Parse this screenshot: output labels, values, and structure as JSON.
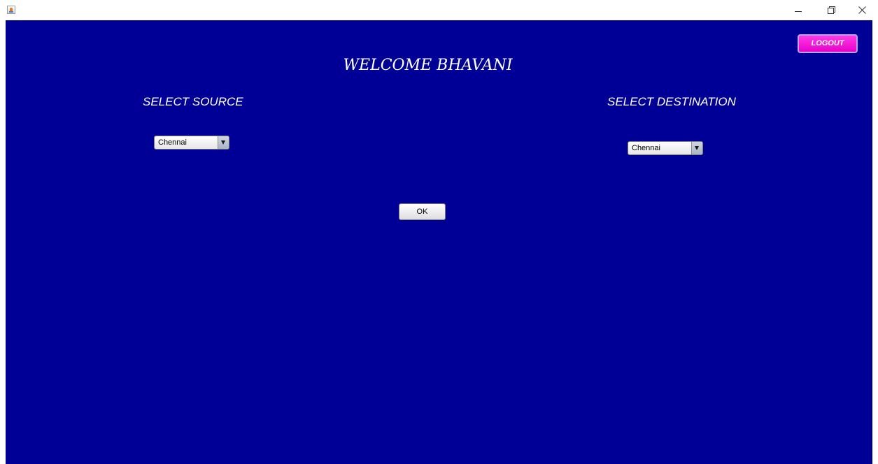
{
  "window": {
    "app_icon": "java-app-icon",
    "controls": [
      "minimize-icon",
      "restore-icon",
      "close-icon"
    ]
  },
  "header": {
    "welcome_text": "WELCOME BHAVANI",
    "logout_label": "LOGOUT"
  },
  "source": {
    "label": "SELECT SOURCE",
    "selected": "Chennai"
  },
  "destination": {
    "label": "SELECT DESTINATION",
    "selected": "Chennai"
  },
  "actions": {
    "ok_label": "OK"
  },
  "colors": {
    "background": "#000096",
    "text": "#ffffff",
    "logout_button": "#ff1ee0"
  }
}
